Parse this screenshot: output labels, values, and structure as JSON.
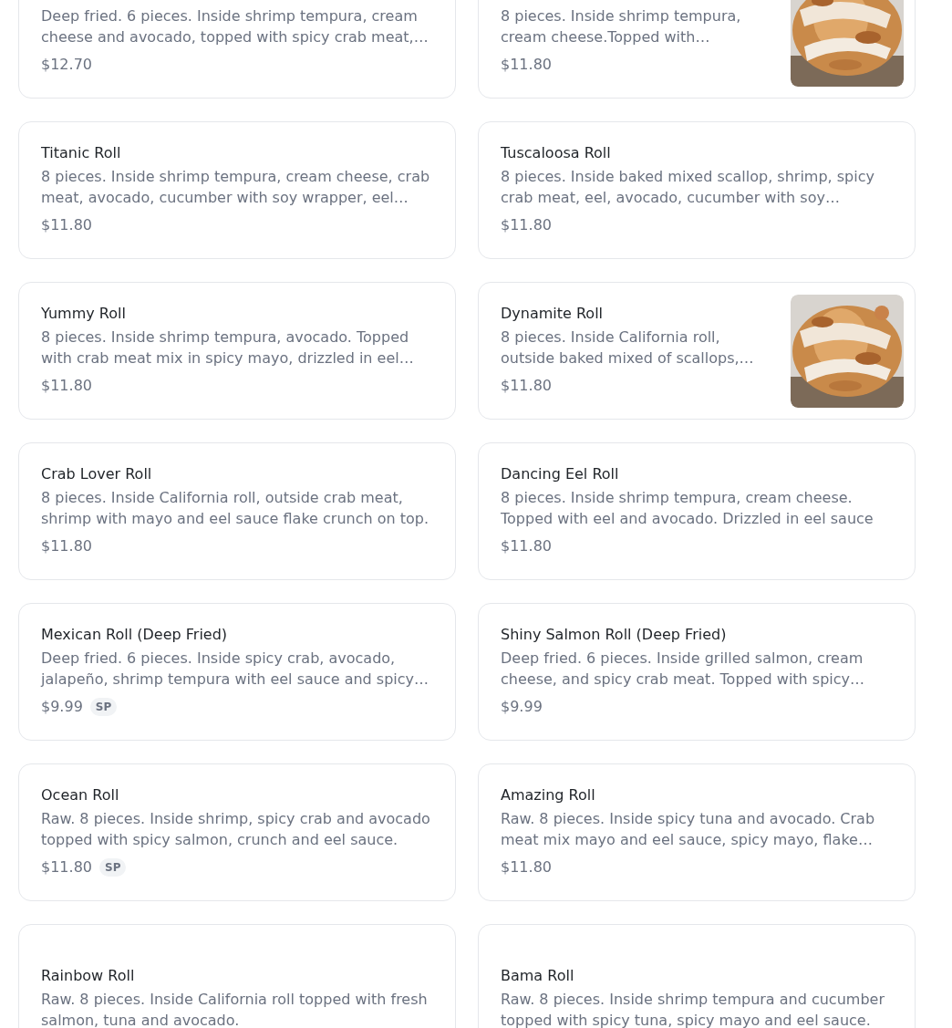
{
  "menu_items": [
    {
      "description": "Deep fried. 6 pieces. Inside shrimp tempura, cream cheese and avocado, topped with spicy crab meat,…",
      "price": "$12.70"
    },
    {
      "description": "8 pieces. Inside shrimp tempura, cream cheese.Topped with…",
      "price": "$11.80"
    },
    {
      "name": "Titanic Roll",
      "description": "8 pieces. Inside shrimp tempura, cream cheese, crab meat, avocado, cucumber with soy wrapper, eel…",
      "price": "$11.80"
    },
    {
      "name": "Tuscaloosa Roll",
      "description": "8 pieces. Inside baked mixed scallop, shrimp, spicy crab meat, eel, avocado, cucumber with soy…",
      "price": "$11.80"
    },
    {
      "name": "Yummy Roll",
      "description": "8 pieces. Inside shrimp tempura, avocado. Topped with crab meat mix in spicy mayo, drizzled in eel…",
      "price": "$11.80"
    },
    {
      "name": "Dynamite Roll",
      "description": "8 pieces. Inside California roll, outside baked mixed of scallops,…",
      "price": "$11.80"
    },
    {
      "name": "Crab Lover Roll",
      "description": "8 pieces. Inside California roll, outside crab meat, shrimp with mayo and eel sauce flake crunch on top.",
      "price": "$11.80"
    },
    {
      "name": "Dancing Eel Roll",
      "description": "8 pieces. Inside shrimp tempura, cream cheese. Topped with eel and avocado. Drizzled in eel sauce",
      "price": "$11.80"
    },
    {
      "name": "Mexican Roll (Deep Fried)",
      "description": "Deep fried. 6 pieces. Inside spicy crab, avocado, jalapeño, shrimp tempura with eel sauce and spicy…",
      "price": "$9.99",
      "badge": "SP"
    },
    {
      "name": "Shiny Salmon Roll (Deep Fried)",
      "description": "Deep fried. 6 pieces. Inside grilled salmon, cream cheese, and spicy crab meat. Topped with spicy…",
      "price": "$9.99"
    },
    {
      "name": "Ocean Roll",
      "description": "Raw. 8 pieces. Inside shrimp, spicy crab and avocado topped with spicy salmon, crunch and eel sauce.",
      "price": "$11.80",
      "badge": "SP"
    },
    {
      "name": "Amazing Roll",
      "description": "Raw. 8 pieces. Inside spicy tuna and avocado. Crab meat mix mayo and eel sauce, spicy mayo, flake…",
      "price": "$11.80"
    },
    {
      "name": "Rainbow Roll",
      "description": "Raw. 8 pieces. Inside California roll topped with fresh salmon, tuna and avocado."
    },
    {
      "name": "Bama Roll",
      "description": "Raw. 8 pieces. Inside shrimp tempura and cucumber topped with spicy tuna, spicy mayo and eel sauce."
    }
  ]
}
